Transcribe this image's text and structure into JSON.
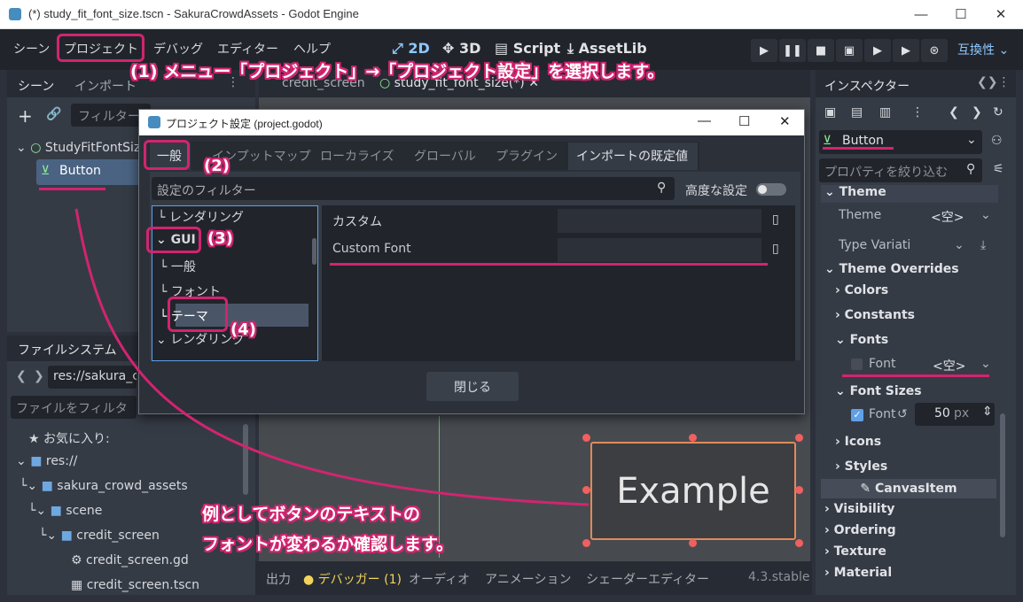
{
  "window": {
    "title": "(*) study_fit_font_size.tscn - SakuraCrowdAssets - Godot Engine",
    "minimize_icon": "—",
    "maximize_icon": "☐",
    "close_icon": "✕"
  },
  "menu": {
    "items": [
      "シーン",
      "プロジェクト",
      "デバッグ",
      "エディター",
      "ヘルプ"
    ],
    "workspaces": [
      "2D",
      "3D",
      "Script",
      "AssetLib"
    ],
    "compat_label": "互換性"
  },
  "scene_dock": {
    "tabs": [
      "シーン",
      "インポート"
    ],
    "filter_placeholder": "フィルター",
    "root_node": "StudyFitFontSize",
    "child_node": "Button"
  },
  "filesystem_dock": {
    "tab": "ファイルシステム",
    "path": "res://sakura_cr",
    "filter_placeholder": "ファイルをフィルタ",
    "favorites": "お気に入り:",
    "tree": [
      "res://",
      "sakura_crowd_assets",
      "scene",
      "credit_screen",
      "credit_screen.gd",
      "credit_screen.tscn"
    ]
  },
  "editor_tabs": [
    "credit_screen",
    "study_fit_font_size(*)"
  ],
  "viewport": {
    "button_text": "Example"
  },
  "bottom_panel": {
    "tabs": [
      "出力",
      "デバッガー (1)",
      "オーディオ",
      "アニメーション",
      "シェーダーエディター"
    ],
    "version": "4.3.stable"
  },
  "inspector": {
    "tab": "インスペクター",
    "node_name": "Button",
    "filter_placeholder": "プロパティを絞り込む",
    "theme_section": "Theme",
    "theme_label": "Theme",
    "theme_value": "<空>",
    "type_variation_label": "Type Variati",
    "theme_overrides": "Theme Overrides",
    "colors": "Colors",
    "constants": "Constants",
    "fonts": "Fonts",
    "font_label": "Font",
    "font_value": "<空>",
    "font_sizes": "Font Sizes",
    "font_size_label": "Font",
    "font_size_value": "50",
    "font_size_unit": "px",
    "icons": "Icons",
    "styles": "Styles",
    "canvas_item": "CanvasItem",
    "visibility": "Visibility",
    "ordering": "Ordering",
    "texture": "Texture",
    "material": "Material"
  },
  "dialog": {
    "title": "プロジェクト設定 (project.godot)",
    "tabs": [
      "一般",
      "インプットマップ",
      "ローカライズ",
      "グローバル",
      "プラグイン",
      "インポートの既定値"
    ],
    "filter_placeholder": "設定のフィルター",
    "advanced_label": "高度な設定",
    "tree": {
      "above": "レンダリング",
      "gui": "GUI",
      "general": "一般",
      "font": "フォント",
      "theme": "テーマ",
      "below": "レンダリング"
    },
    "settings": [
      {
        "label": "カスタム"
      },
      {
        "label": "Custom Font"
      }
    ],
    "close_button": "閉じる"
  },
  "annotations": {
    "step1": "(1) メニュー「プロジェクト」→「プロジェクト設定」を選択します。",
    "step2": "(2)",
    "step3": "(3)",
    "step4": "(4)",
    "caption_line1": "例としてボタンのテキストの",
    "caption_line2": "フォントが変わるか確認します。"
  },
  "colors": {
    "accent": "#d22470",
    "node_green": "#8eef97",
    "godot_blue": "#478cbf"
  }
}
